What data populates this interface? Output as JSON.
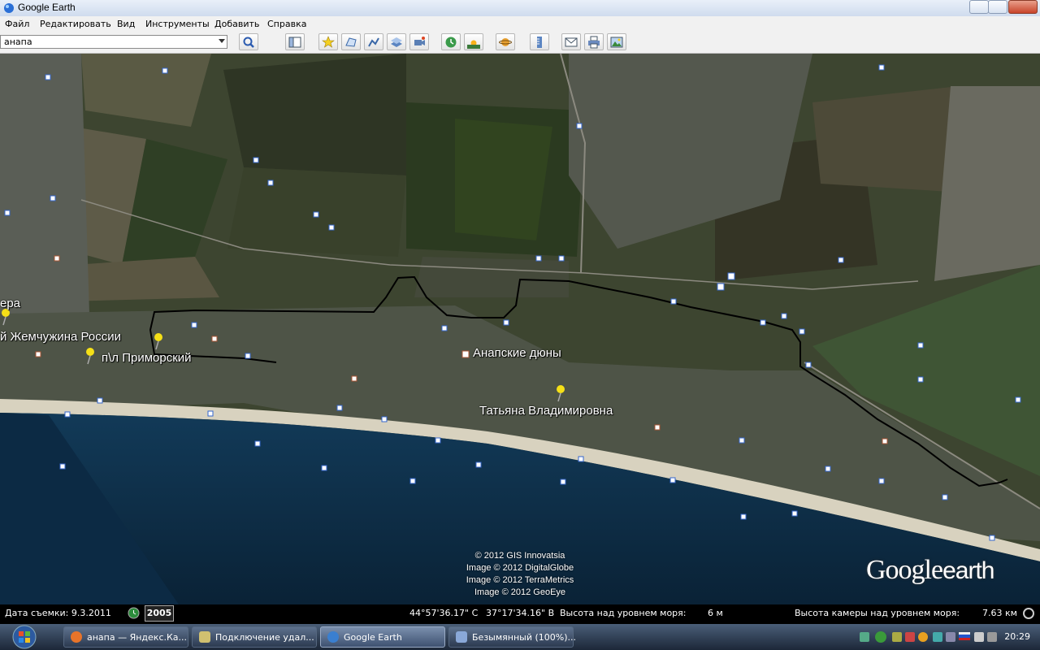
{
  "window": {
    "title": "Google Earth"
  },
  "menu": [
    "Файл",
    "Редактировать",
    "Вид",
    "Инструменты",
    "Добавить",
    "Справка"
  ],
  "search": {
    "value": "анапа"
  },
  "toolbar_icons": [
    "sidebar-icon",
    "placemark-icon",
    "polygon-icon",
    "path-icon",
    "overlay-icon",
    "record-tour-icon",
    "historical-imagery-icon",
    "sunlight-icon",
    "planets-icon",
    "ruler-icon",
    "email-icon",
    "print-icon",
    "save-image-icon"
  ],
  "map": {
    "labels": {
      "label_era": "ера",
      "label_zhemchuzhina": "й Жемчужина России",
      "label_primorsky": "п\\л Приморский",
      "label_anapskie": "Анапские дюны",
      "label_tatiana": "Татьяна Владимировна"
    },
    "attribution": [
      "© 2012 GIS Innovatsia",
      "Image © 2012 DigitalGlobe",
      "Image © 2012 TerraMetrics",
      "Image © 2012 GeoEye"
    ],
    "logo": {
      "part1": "Google",
      "part2": "earth"
    }
  },
  "status": {
    "date_label": "Дата съемки: 9.3.2011",
    "year": "2005",
    "lat": "44°57'36.17\" С",
    "lon": "37°17'34.16\" В",
    "elev_label": "Высота над уровнем моря:",
    "elev_value": "6 м",
    "cam_label": "Высота камеры над уровнем моря:",
    "cam_value": "7.63 км"
  },
  "taskbar": {
    "tasks": [
      {
        "label": "анапа — Яндекс.Ка...",
        "icon_color": "#e8742a"
      },
      {
        "label": "Подключение удал...",
        "icon_color": "#d0c070"
      },
      {
        "label": "Google Earth",
        "icon_color": "#3a7fd0"
      },
      {
        "label": "Безымянный (100%)...",
        "icon_color": "#8aa8d8"
      }
    ],
    "clock": "20:29"
  }
}
